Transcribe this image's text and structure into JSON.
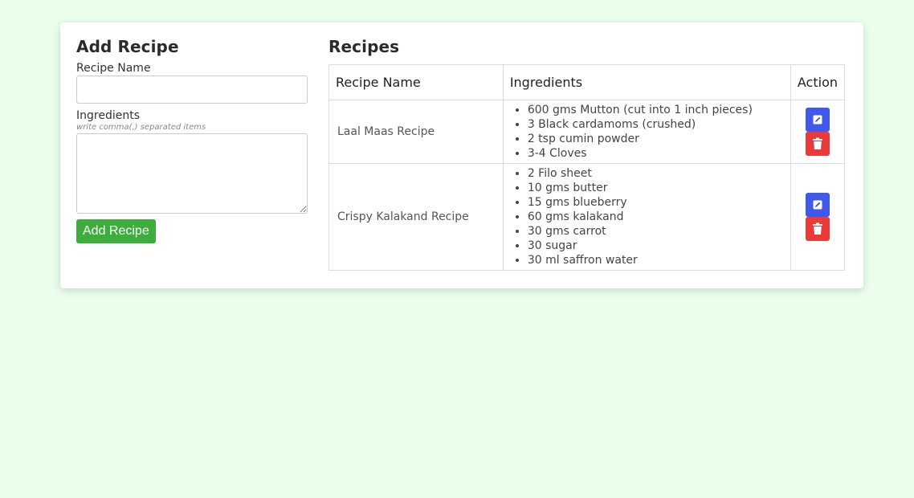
{
  "form": {
    "title": "Add Recipe",
    "name_label": "Recipe Name",
    "name_value": "",
    "name_placeholder": "",
    "ingredients_label": "Ingredients",
    "ingredients_hint": "write comma(,) separated items",
    "ingredients_value": "",
    "submit_label": "Add Recipe"
  },
  "list": {
    "title": "Recipes",
    "columns": [
      "Recipe Name",
      "Ingredients",
      "Action"
    ],
    "rows": [
      {
        "name": "Laal Maas Recipe",
        "ingredients": [
          "600 gms Mutton (cut into 1 inch pieces)",
          "3 Black cardamoms (crushed)",
          "2 tsp cumin powder",
          "3-4 Cloves"
        ]
      },
      {
        "name": "Crispy Kalakand Recipe",
        "ingredients": [
          "2 Filo sheet",
          "10 gms butter",
          "15 gms blueberry",
          "60 gms kalakand",
          "30 gms carrot",
          "30 sugar",
          "30 ml saffron water"
        ]
      }
    ]
  },
  "icons": {
    "edit": "pencil-icon",
    "delete": "trash-icon"
  },
  "colors": {
    "background": "#ebfdeb",
    "add_button": "#3dad3d",
    "edit_button": "#4159ea",
    "delete_button": "#ea3b3b"
  }
}
